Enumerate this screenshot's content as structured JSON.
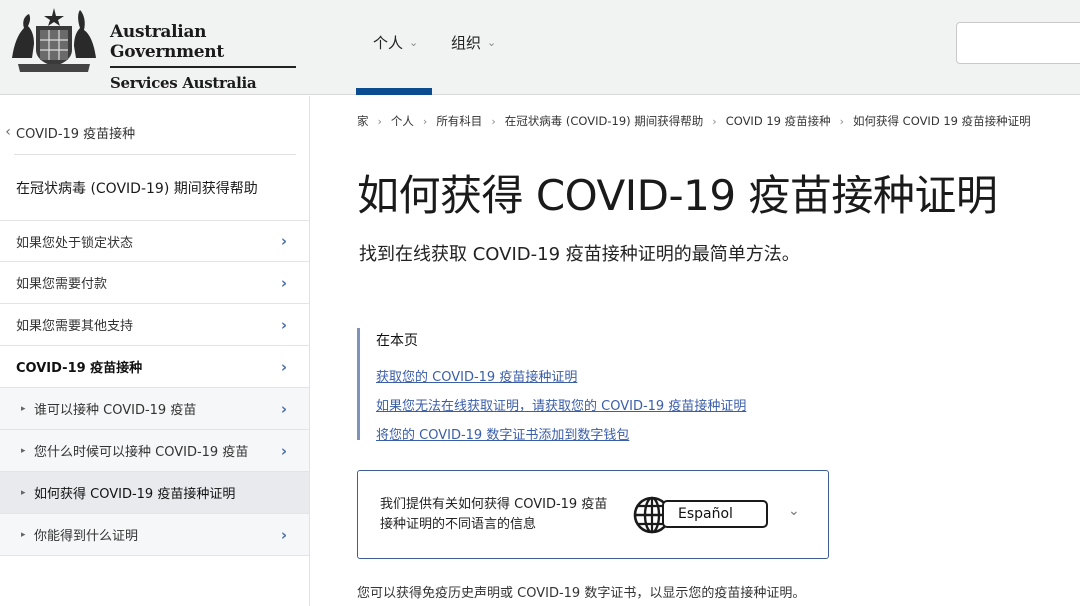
{
  "header": {
    "brand_line1": "Australian Government",
    "brand_line2": "Services Australia",
    "nav": [
      {
        "label": "个人"
      },
      {
        "label": "组织"
      }
    ],
    "accent_color": "#0b4b8f"
  },
  "sidebar": {
    "back_label": "COVID-19 疫苗接种",
    "section_title": "在冠状病毒 (COVID-19) 期间获得帮助",
    "items": [
      {
        "label": "如果您处于锁定状态"
      },
      {
        "label": "如果您需要付款"
      },
      {
        "label": "如果您需要其他支持"
      },
      {
        "label": "COVID-19 疫苗接种"
      },
      {
        "label": "谁可以接种 COVID-19 疫苗"
      },
      {
        "label": "您什么时候可以接种 COVID-19 疫苗"
      },
      {
        "label": "如何获得 COVID-19 疫苗接种证明"
      },
      {
        "label": "你能得到什么证明"
      }
    ]
  },
  "breadcrumb": [
    {
      "label": "家"
    },
    {
      "label": "个人"
    },
    {
      "label": "所有科目"
    },
    {
      "label": "在冠状病毒 (COVID-19) 期间获得帮助"
    },
    {
      "label": "COVID 19 疫苗接种"
    },
    {
      "label": "如何获得 COVID 19 疫苗接种证明"
    }
  ],
  "main": {
    "title": "如何获得 COVID-19 疫苗接种证明",
    "lede": "找到在线获取 COVID-19 疫苗接种证明的最简单方法。",
    "toc": {
      "title": "在本页",
      "links": [
        {
          "label": "获取您的 COVID-19 疫苗接种证明"
        },
        {
          "label": "如果您无法在线获取证明，请获取您的 COVID-19 疫苗接种证明"
        },
        {
          "label": "将您的 COVID-19 数字证书添加到数字钱包"
        }
      ]
    },
    "language_box": {
      "text": "我们提供有关如何获得 COVID-19 疫苗接种证明的不同语言的信息",
      "selected_language": "Español"
    },
    "footer_text": "您可以获得免疫历史声明或 COVID-19 数字证书，以显示您的疫苗接种证明。"
  }
}
